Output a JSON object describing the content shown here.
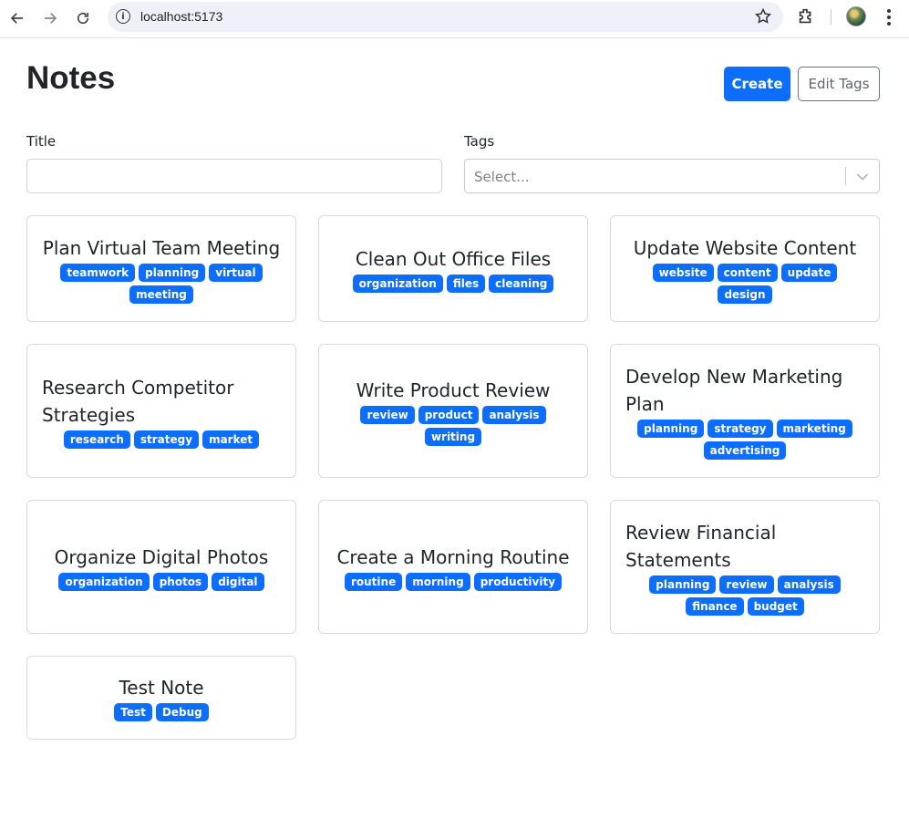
{
  "browser": {
    "url": "localhost:5173"
  },
  "page": {
    "title": "Notes",
    "create_label": "Create",
    "edit_tags_label": "Edit Tags"
  },
  "filters": {
    "title_label": "Title",
    "title_value": "",
    "tags_label": "Tags",
    "tags_placeholder": "Select..."
  },
  "notes": [
    {
      "title": "Plan Virtual Team Meeting",
      "tags": [
        "teamwork",
        "planning",
        "virtual",
        "meeting"
      ]
    },
    {
      "title": "Clean Out Office Files",
      "tags": [
        "organization",
        "files",
        "cleaning"
      ]
    },
    {
      "title": "Update Website Content",
      "tags": [
        "website",
        "content",
        "update",
        "design"
      ]
    },
    {
      "title": "Research Competitor Strategies",
      "tags": [
        "research",
        "strategy",
        "market"
      ]
    },
    {
      "title": "Write Product Review",
      "tags": [
        "review",
        "product",
        "analysis",
        "writing"
      ]
    },
    {
      "title": "Develop New Marketing Plan",
      "tags": [
        "planning",
        "strategy",
        "marketing",
        "advertising"
      ]
    },
    {
      "title": "Organize Digital Photos",
      "tags": [
        "organization",
        "photos",
        "digital"
      ]
    },
    {
      "title": "Create a Morning Routine",
      "tags": [
        "routine",
        "morning",
        "productivity"
      ]
    },
    {
      "title": "Review Financial Statements",
      "tags": [
        "planning",
        "review",
        "analysis",
        "finance",
        "budget"
      ]
    },
    {
      "title": "Test Note",
      "tags": [
        "Test",
        "Debug"
      ]
    }
  ],
  "colors": {
    "primary": "#0d6efd",
    "border": "#d8dbdf"
  }
}
